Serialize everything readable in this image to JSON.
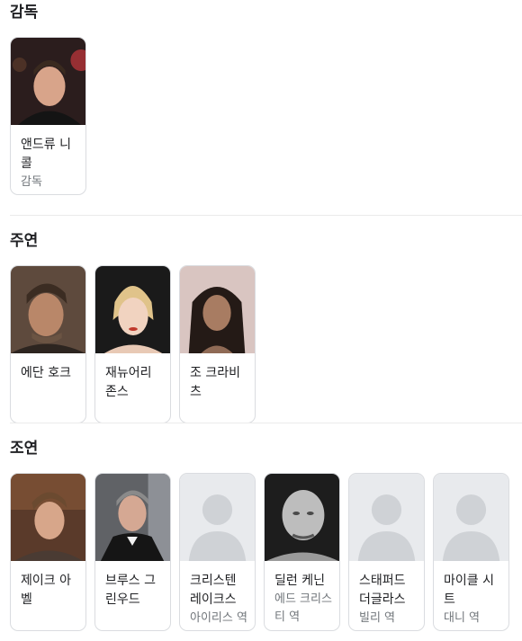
{
  "sections": {
    "director": {
      "title": "감독",
      "people": [
        {
          "name": "앤드류 니콜",
          "role": "감독",
          "photo": "photo"
        }
      ]
    },
    "main_cast": {
      "title": "주연",
      "people": [
        {
          "name": "에단 호크",
          "role": "",
          "photo": "photo"
        },
        {
          "name": "재뉴어리 존스",
          "role": "",
          "photo": "photo"
        },
        {
          "name": "조 크라비츠",
          "role": "",
          "photo": "photo"
        }
      ]
    },
    "supporting_cast": {
      "title": "조연",
      "people": [
        {
          "name": "제이크 아벨",
          "role": "",
          "photo": "photo"
        },
        {
          "name": "브루스 그린우드",
          "role": "",
          "photo": "photo"
        },
        {
          "name": "크리스텐 레이크스",
          "role": "아이리스 역",
          "photo": "placeholder"
        },
        {
          "name": "딜런 케닌",
          "role": "에드 크리스티 역",
          "photo": "photo"
        },
        {
          "name": "스태퍼드 더글라스",
          "role": "빌리 역",
          "photo": "placeholder"
        },
        {
          "name": "마이클 시트",
          "role": "대니 역",
          "photo": "placeholder"
        }
      ]
    }
  },
  "colors": {
    "border": "#dadce0",
    "secondary_text": "#70757a",
    "placeholder_bg": "#e8eaed",
    "placeholder_fg": "#bdc1c6"
  }
}
